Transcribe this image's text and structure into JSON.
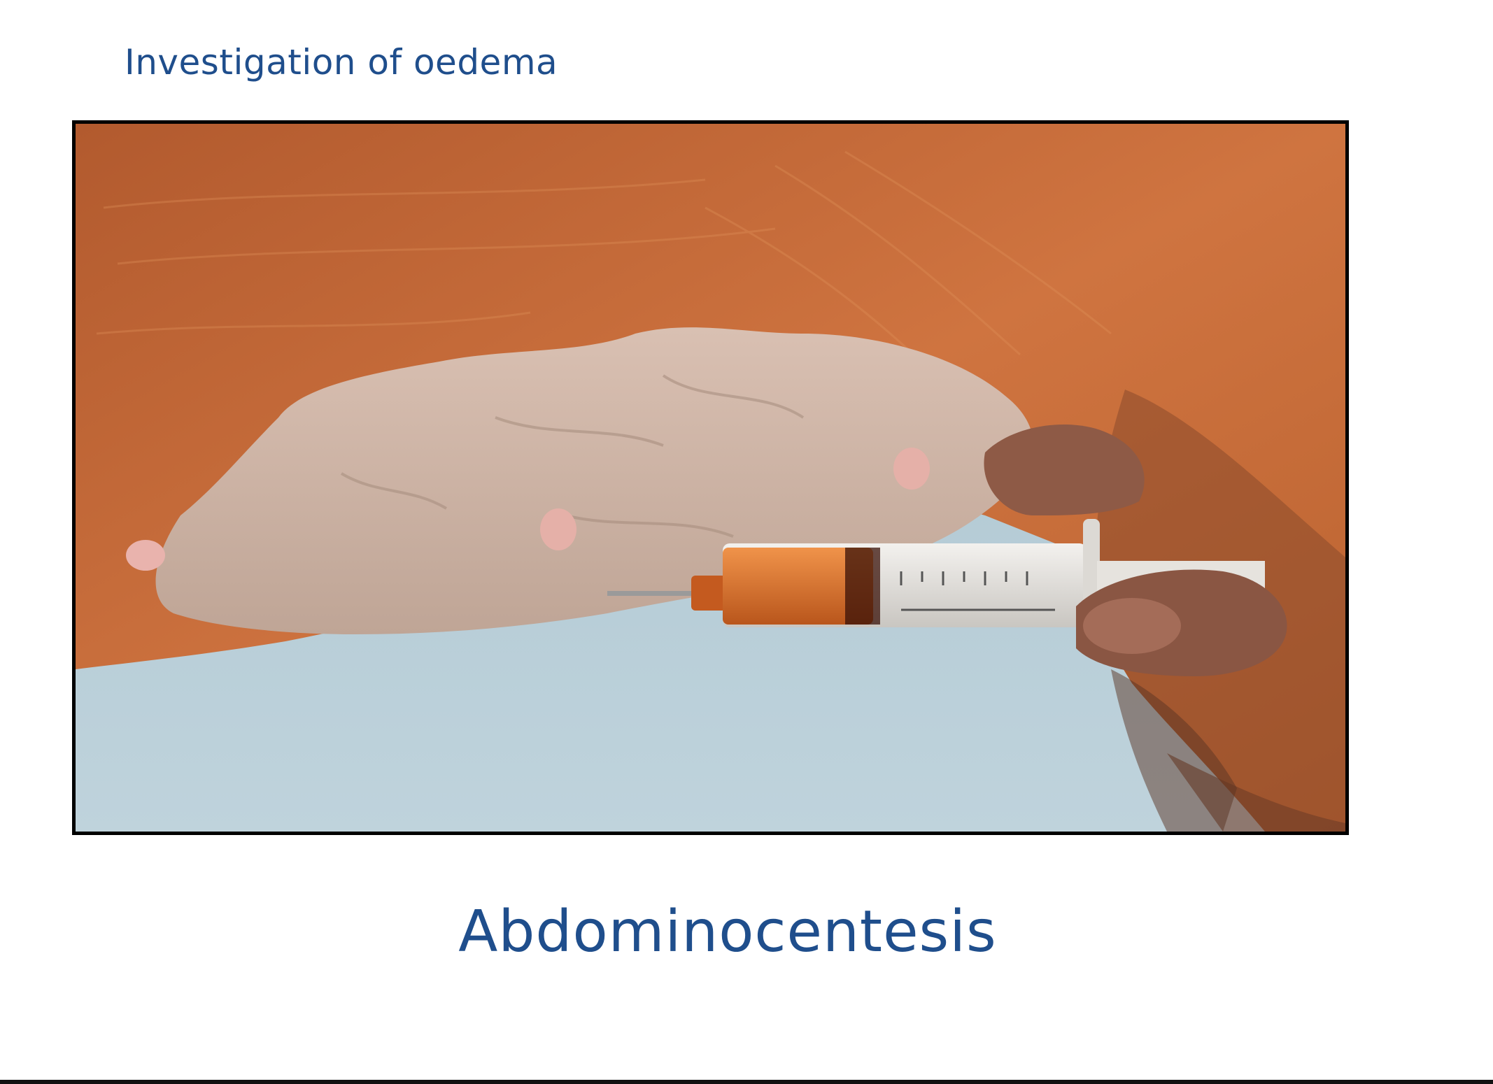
{
  "slide": {
    "title": "Investigation of oedema",
    "caption": "Abdominocentesis"
  },
  "photo": {
    "subject": "photo-abdominocentesis-cow",
    "colors": {
      "hide": "#c66a3a",
      "udder": "#cdb4a6",
      "background": "#b4ccd6",
      "syringe_fluid": "#d9782f",
      "hand": "#8e5a46"
    }
  },
  "theme": {
    "text_color": "#1f4e8c",
    "frame_color": "#000000"
  }
}
